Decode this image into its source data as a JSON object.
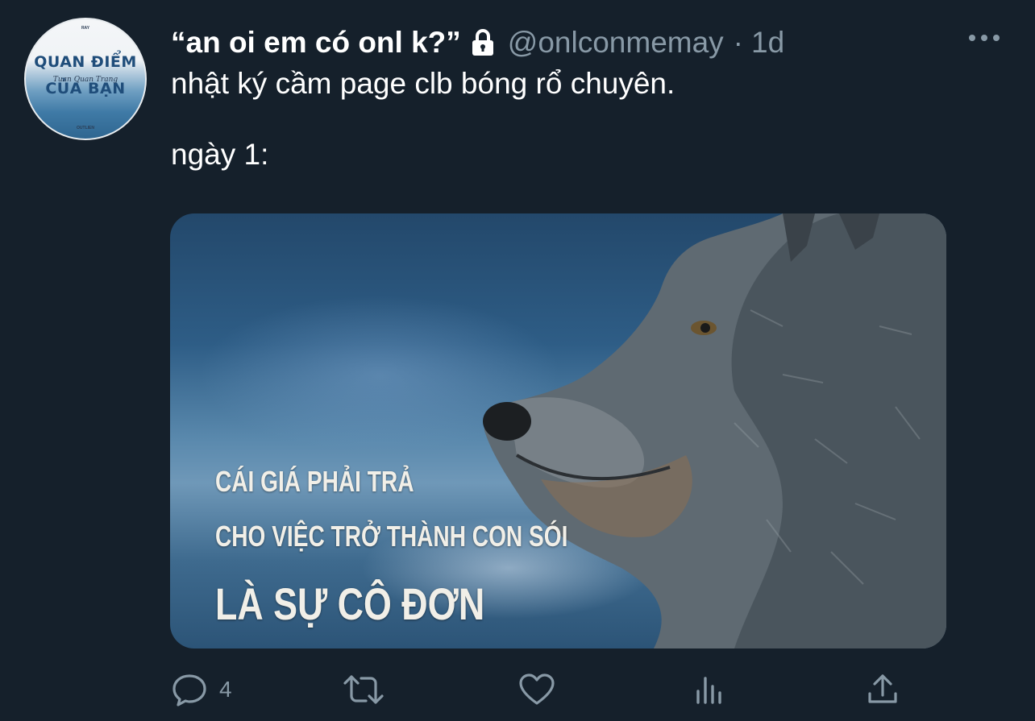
{
  "tweet": {
    "display_name": "“an oi em có onl k?”",
    "handle": "@onlconmemay",
    "separator": "·",
    "time": "1d",
    "text_line1": "nhật ký cầm page clb bóng rổ chuyên.",
    "text_line2": "ngày 1:",
    "protected": true
  },
  "avatar": {
    "cover_title_line1": "QUAN ĐIỂM",
    "cover_title_line2": "CỦA BẠN",
    "cover_subtitle": "Tuan Quan Trang",
    "cover_top": "RAY",
    "cover_bottom": "OUTLIEN"
  },
  "media": {
    "caption_line1": "CÁI GIÁ PHẢI TRẢ",
    "caption_line2": "CHO VIỆC TRỞ THÀNH CON SÓI",
    "caption_line3": "LÀ SỰ CÔ ĐƠN"
  },
  "actions": {
    "reply_count": "4",
    "retweet_count": "",
    "like_count": ""
  },
  "icons": {
    "lock": "lock-icon",
    "more": "more-horizontal-icon",
    "reply": "reply-icon",
    "retweet": "retweet-icon",
    "like": "heart-icon",
    "analytics": "analytics-icon",
    "share": "share-icon"
  },
  "colors": {
    "background": "#15202b",
    "secondary_text": "#8899a6",
    "primary_text": "#ffffff"
  }
}
